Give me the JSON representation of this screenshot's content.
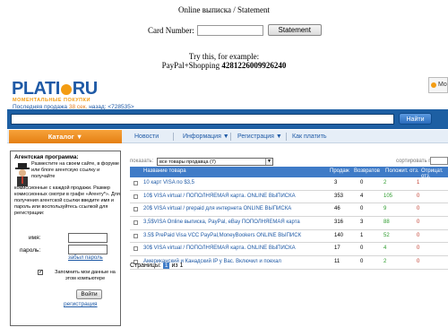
{
  "top": {
    "title": "Online выписка / Statement",
    "card_label": "Card Number:",
    "card_value": "",
    "statement_button": "Statement",
    "try_line": "Try this, for example:",
    "example_prefix": "PayPal+Shopping ",
    "example_number": "4281226009926240"
  },
  "site": {
    "logo": {
      "left": "PLATI",
      "right": "RU",
      "tagline": "МОМЕНТАЛЬНЫЕ ПОКУПКИ"
    },
    "last_sale": {
      "prefix": "Последняя продажа ",
      "time": "38 сек.",
      "middle": " назад: <",
      "link": "728535",
      "suffix": ">"
    },
    "my_box_label": "Мо",
    "search": {
      "value": "",
      "button": "Найти"
    },
    "nav": {
      "catalog": "Каталог ▼",
      "items": [
        "Новости",
        "Информация ▼",
        "Регистрация ▼",
        "Как платить"
      ]
    },
    "agent": {
      "title": "Агентская программа:",
      "text1": "Разместите на своем сайте, в форуме или блоге агентскую ссылку и получайте",
      "text2": "комиссионные с каждой продажи. Размер комиссионных смотри в графе «Агенту*». Для получения агентской ссылки введите имя и пароль или воспользуйтесь ссылкой для регистрации:",
      "name_label": "имя:",
      "password_label": "пароль:",
      "forgot": "забыл пароль",
      "remember": "Запомнить мои данные на этом компьютере",
      "remember_checked": "✓",
      "login_button": "Войти",
      "register_link": "регистрация"
    },
    "list": {
      "show_label": "показать:",
      "show_value": "все товары продавца (7)",
      "sort_label": "сортировать по:",
      "headers": [
        "Название товара",
        "Продаж",
        "Возвратов",
        "Положит. отз.",
        "Отрицат. отз."
      ],
      "rows": [
        {
          "name": "10 карт VISA по $3,5",
          "sales": "3",
          "returns": "0",
          "pos": "2",
          "neg": "1"
        },
        {
          "name": "10$ VISA virtual / ПОПОЛНЯЕМАЯ карта. ONLINE ВЫПИСКА",
          "sales": "353",
          "returns": "4",
          "pos": "105",
          "neg": "0"
        },
        {
          "name": "20$ VISA virtual / prepaid для интернета ONLINE ВЫПИСКА",
          "sales": "46",
          "returns": "0",
          "pos": "9",
          "neg": "0"
        },
        {
          "name": "3,5$VISA Online выписка, PayPal, eBay ПОПОЛНЯЕМАЯ карта",
          "sales": "316",
          "returns": "3",
          "pos": "88",
          "neg": "0"
        },
        {
          "name": "3.5$ PrePaid Visa VCC PayPal,MoneyBookers ONLINE ВЫПИСК",
          "sales": "140",
          "returns": "1",
          "pos": "52",
          "neg": "0"
        },
        {
          "name": "30$ VISA virtual / ПОПОЛНЯЕМАЯ карта. ONLINE ВЫПИСКА",
          "sales": "17",
          "returns": "0",
          "pos": "4",
          "neg": "0"
        },
        {
          "name": "Американский и Канадский IP у Вас. Включил и поехал",
          "sales": "11",
          "returns": "0",
          "pos": "2",
          "neg": "0"
        }
      ],
      "pages_label": "Страницы:",
      "current_page": "1",
      "of_label": "из 1"
    }
  }
}
